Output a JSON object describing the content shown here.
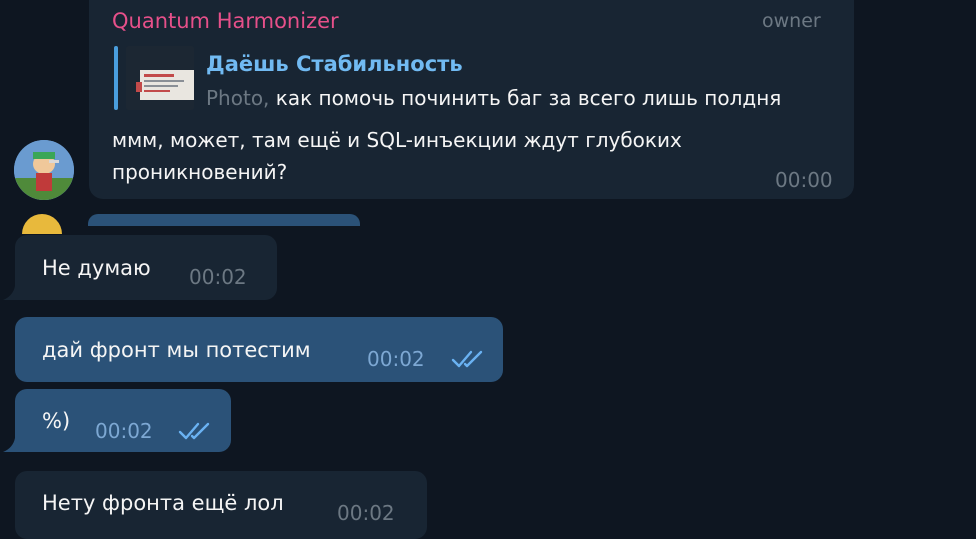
{
  "messages": {
    "top": {
      "sender": "Quantum Harmonizer",
      "role_tag": "owner",
      "reply": {
        "title": "Даёшь Стабильность",
        "prefix": "Photo,",
        "text": "как помочь починить баг за всего лишь полдня"
      },
      "text": "ммм, может, там ещё и SQL-инъекции ждут глубоких проникновений?",
      "time": "00:00"
    },
    "m1": {
      "text": "Не думаю",
      "time": "00:02",
      "direction": "incoming"
    },
    "m2": {
      "text": "дай фронт мы потестим",
      "time": "00:02",
      "direction": "outgoing",
      "status": "read"
    },
    "m3": {
      "text": "%)",
      "time": "00:02",
      "direction": "outgoing",
      "status": "read"
    },
    "m4": {
      "text": "Нету фронта ещё лол",
      "time": "00:02",
      "direction": "incoming"
    }
  },
  "colors": {
    "background": "#0e1621",
    "incoming_bubble": "#182533",
    "outgoing_bubble": "#2b5278",
    "sender_name": "#e6508a",
    "reply_accent": "#71baf2",
    "read_check": "#6ab2f2"
  },
  "icons": {
    "read_status": "double-check-icon"
  }
}
